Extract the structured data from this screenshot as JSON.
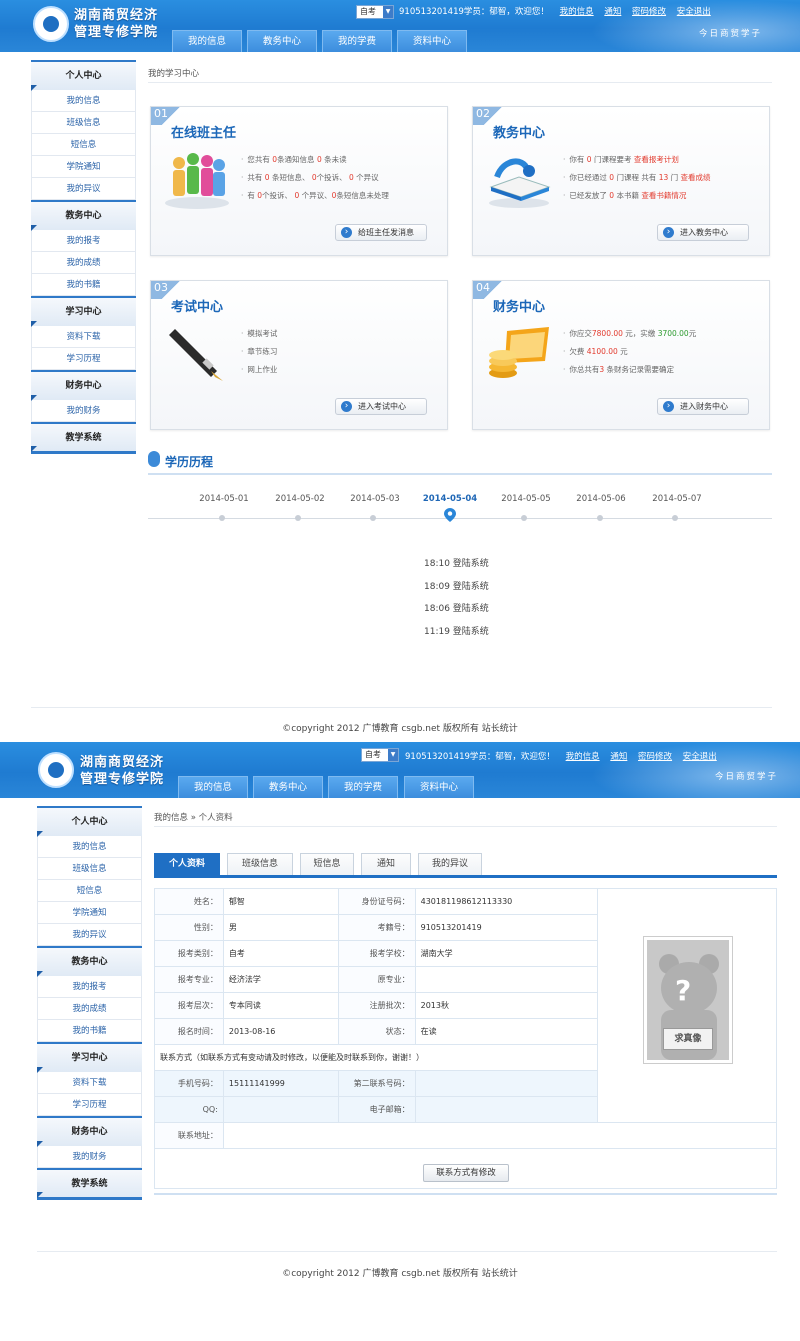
{
  "header": {
    "logo_line1": "湖南商贸经济",
    "logo_line2": "管理专修学院",
    "exam_select": "自考",
    "user_text": "910513201419学员：郁智，欢迎您！",
    "links": [
      "我的信息",
      "通知",
      "密码修改",
      "安全退出"
    ],
    "slogan": "今日商贸学子",
    "nav": [
      "我的信息",
      "教务中心",
      "我的学费",
      "资料中心"
    ]
  },
  "sidebar": {
    "groups": [
      {
        "title": "个人中心",
        "items": [
          "我的信息",
          "班级信息",
          "短信息",
          "学院通知",
          "我的异议"
        ]
      },
      {
        "title": "教务中心",
        "items": [
          "我的报考",
          "我的成绩",
          "我的书籍"
        ]
      },
      {
        "title": "学习中心",
        "items": [
          "资料下载",
          "学习历程"
        ]
      },
      {
        "title": "财务中心",
        "items": [
          "我的财务"
        ]
      },
      {
        "title": "教学系统",
        "items": []
      }
    ]
  },
  "dashboard": {
    "crumb": "我的学习中心",
    "cards": [
      {
        "num": "01",
        "title": "在线班主任",
        "lines": [
          [
            "您共有 ",
            "0",
            "条通知信息 ",
            "0",
            " 条未读"
          ],
          [
            "共有 ",
            "0",
            " 条短信息、 ",
            "0",
            "个投诉、 ",
            "0",
            " 个异议"
          ],
          [
            "有 ",
            "0",
            "个投诉、 ",
            "0",
            " 个异议、",
            "0",
            "条短信息未处理"
          ]
        ],
        "button": "给班主任发消息"
      },
      {
        "num": "02",
        "title": "教务中心",
        "lines": [
          [
            "你有 ",
            "0",
            " 门课程要考 ",
            "查看报考计划"
          ],
          [
            "你已经通过 ",
            "0",
            " 门课程 共有 ",
            "13",
            " 门 ",
            "查看成绩"
          ],
          [
            "已经发放了 ",
            "0",
            " 本书籍 ",
            "查看书籍情况"
          ]
        ],
        "button": "进入教务中心"
      },
      {
        "num": "03",
        "title": "考试中心",
        "lines": [
          [
            "模拟考试"
          ],
          [
            "章节练习"
          ],
          [
            "网上作业"
          ]
        ],
        "button": "进入考试中心"
      },
      {
        "num": "04",
        "title": "财务中心",
        "lines": [
          [
            "你应交",
            "7800.00",
            " 元，实缴 ",
            "3700.00",
            "元"
          ],
          [
            "欠费 ",
            "4100.00",
            " 元"
          ],
          [
            "你总共有",
            "3",
            " 条财务记录需要确定"
          ]
        ],
        "button": "进入财务中心"
      }
    ],
    "timeline_title": "学历历程",
    "dates": [
      "2014-05-01",
      "2014-05-02",
      "2014-05-03",
      "2014-05-04",
      "2014-05-05",
      "2014-05-06",
      "2014-05-07"
    ],
    "active_date": "2014-05-04",
    "logs": [
      "18:10 登陆系统",
      "18:09 登陆系统",
      "18:06 登陆系统",
      "11:19 登陆系统"
    ]
  },
  "profile": {
    "crumb": "我的信息 » 个人资料",
    "tabs": [
      "个人资料",
      "班级信息",
      "短信息",
      "通知",
      "我的异议"
    ],
    "fields": {
      "name_label": "姓名：",
      "name": "郁智",
      "idcard_label": "身份证号码：",
      "idcard": "430181198612113330",
      "gender_label": "性别：",
      "gender": "男",
      "examno_label": "考籍号：",
      "examno": "910513201419",
      "type_label": "报考类别：",
      "type": "自考",
      "school_label": "报考学校：",
      "school": "湖南大学",
      "major_label": "报考专业：",
      "major": "经济法学",
      "origmajor_label": "原专业：",
      "origmajor": "",
      "level_label": "报考层次：",
      "level": "专本同读",
      "batch_label": "注册批次：",
      "batch": "2013秋",
      "date_label": "报名时间：",
      "date": "2013-08-16",
      "status_label": "状态：",
      "status": "在读",
      "contact_note": "联系方式（如联系方式有变动请及时修改，以便能及时联系到你，谢谢！）",
      "phone_label": "手机号码：",
      "phone": "15111141999",
      "phone2_label": "第二联系号码：",
      "phone2": "",
      "qq_label": "QQ:",
      "qq": "",
      "email_label": "电子邮箱：",
      "email": "",
      "addr_label": "联系地址：",
      "addr": ""
    },
    "photo_sign": "求真像",
    "modify_button": "联系方式有修改"
  },
  "footer": "©copyright 2012 广博教育 csgb.net 版权所有 站长统计",
  "colors": {
    "brand_blue": "#1f7bd1",
    "accent_red": "#e23b2e",
    "accent_green": "#2d9b2f"
  }
}
